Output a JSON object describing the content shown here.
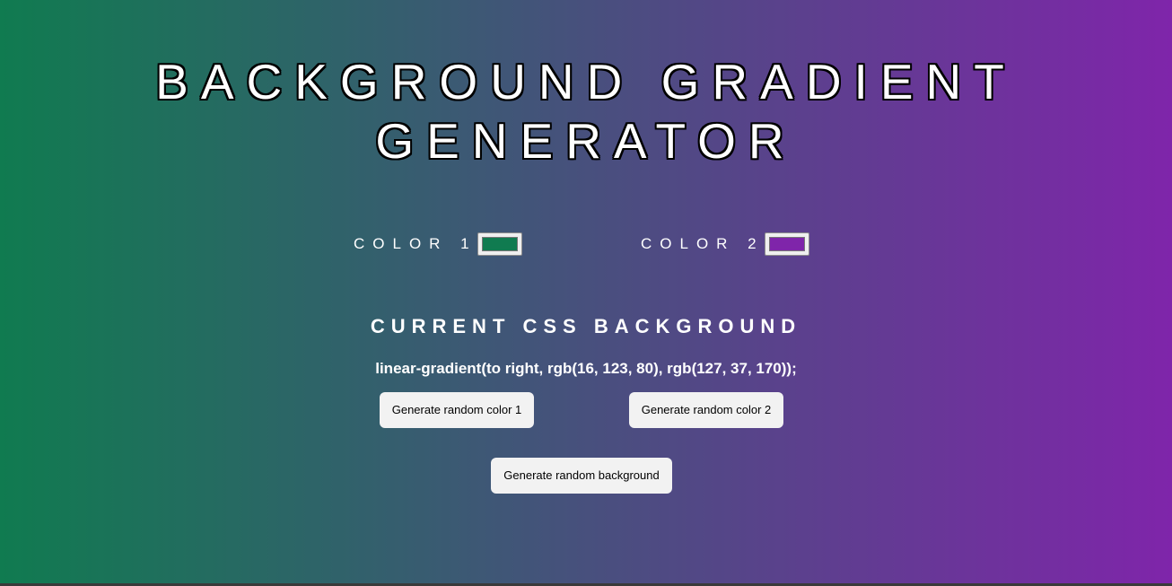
{
  "title": {
    "line1": "BACKGROUND GRADIENT",
    "line2": "GENERATOR"
  },
  "colors": {
    "color1": {
      "label": "COLOR 1",
      "value": "#107b50"
    },
    "color2": {
      "label": "COLOR 2",
      "value": "#7f25aa"
    }
  },
  "current": {
    "heading": "CURRENT CSS BACKGROUND",
    "css_text": "linear-gradient(to right, rgb(16, 123, 80), rgb(127, 37, 170));"
  },
  "buttons": {
    "random_color1": "Generate random color 1",
    "random_color2": "Generate random color 2",
    "random_background": "Generate random background"
  }
}
